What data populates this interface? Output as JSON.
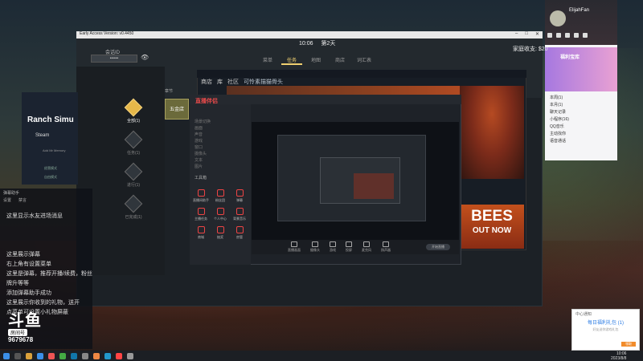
{
  "game": {
    "window_title": "Early Access Version: v0.4450",
    "clock": "10:06",
    "day": "第2天",
    "session_label": "会话ID",
    "session_value": "••••••",
    "money": "家庭收支: $20",
    "tabs": [
      "菜单",
      "任务",
      "地图",
      "商店",
      "词汇表"
    ],
    "active_tab": "任务",
    "section_label": "章节",
    "steps": [
      {
        "label": "全部(1)",
        "active": true
      },
      {
        "label": "任务(1)",
        "active": false
      },
      {
        "label": "进行(1)",
        "active": false
      },
      {
        "label": "已完成(1)",
        "active": false
      }
    ],
    "card": "五金店"
  },
  "steam": {
    "nav": [
      "商店",
      "库",
      "社区"
    ],
    "sub": "可怜素描猫骨头",
    "bees_title": "BEES",
    "bees_sub": "OUT NOW"
  },
  "obs": {
    "logo": "直播伴侣",
    "side_items": [
      "场景切换",
      "画面",
      "声音",
      "游戏",
      "窗口",
      "摄像头",
      "文本",
      "图片"
    ],
    "tools_label": "工具箱",
    "tools": [
      "直播间助手",
      "粉丝团",
      "弹幕",
      "主播任务",
      "个人中心",
      "背景音乐",
      "商城",
      "抽奖",
      "房管"
    ],
    "bottom_tools": [
      "直播画面",
      "摄像头",
      "游戏",
      "投屏",
      "麦克风",
      "扬声器"
    ],
    "golive": "开始直播"
  },
  "ranch": {
    "title": "Ranch Simu",
    "steam": "Steam",
    "wishlist": "Add Mr Memory",
    "items": [
      "经营模式",
      "自由模式"
    ]
  },
  "chat": {
    "header": "弹幕助手",
    "tools": [
      "设置",
      "禁言"
    ],
    "lines": [
      "这里显示水友进场消息",
      "",
      "",
      "这里展示弹幕",
      "右上角有设置菜单",
      "这里是弹幕，推荐开播/续费，粉丝",
      "牌升等等",
      "添加弹幕助手成功",
      "这里展示你收到的礼物，送开",
      "点菜单可设置小礼物屏蔽"
    ]
  },
  "douyu": {
    "name": "斗鱼",
    "tag": "房间号",
    "number": "9679678"
  },
  "qq": {
    "name": "ElijahFan",
    "banner": "福利宝库",
    "rows": [
      "本周(1)",
      "本月(1)",
      "聊天记录",
      "小程序(16)",
      "QQ音乐",
      "主动找你",
      "语音通话"
    ]
  },
  "notification": {
    "title": "中心通知",
    "main": "每日福利礼包 (1)",
    "sub": "好友送你游戏礼包 ",
    "button": "领取"
  },
  "taskbar": {
    "time": "10:06",
    "date": "2023/8/8"
  }
}
